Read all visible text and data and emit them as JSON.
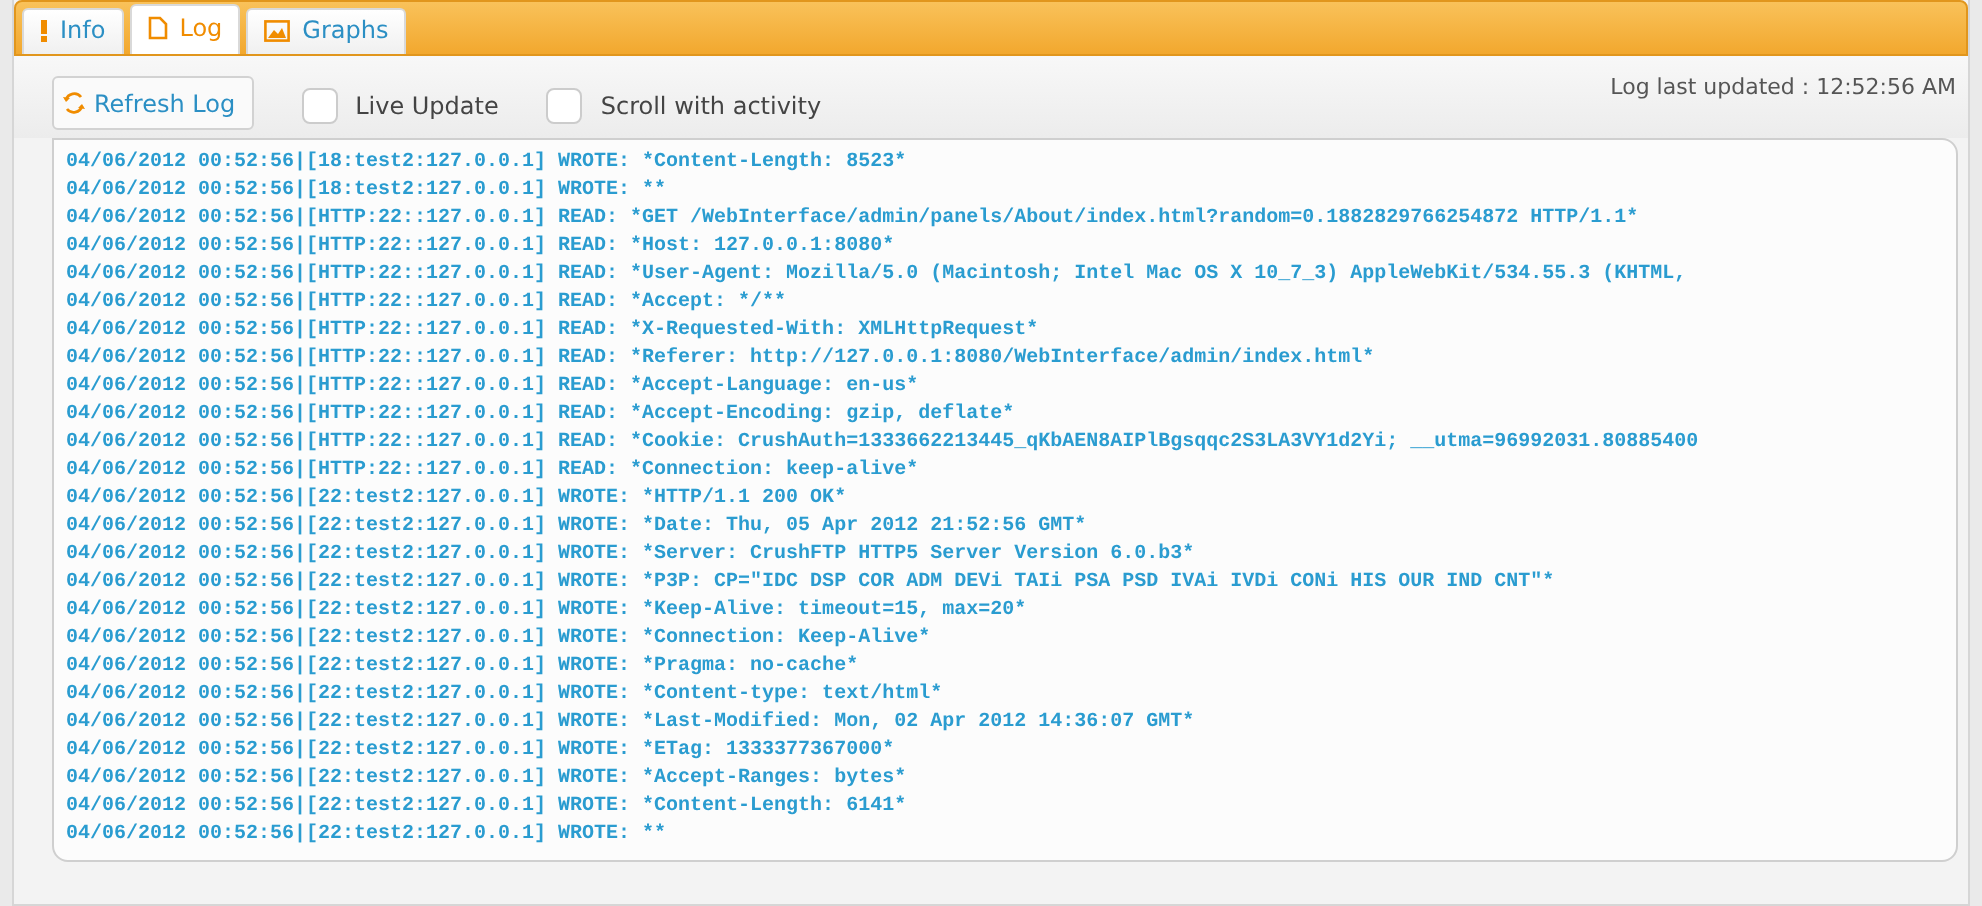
{
  "tabs": [
    {
      "label": "Info",
      "kind": "info",
      "selected": false
    },
    {
      "label": "Log",
      "kind": "log",
      "selected": true
    },
    {
      "label": "Graphs",
      "kind": "graphs",
      "selected": false
    }
  ],
  "toolbar": {
    "refresh_button": "Refresh Log",
    "options": [
      {
        "label": "Live Update",
        "checked": false
      },
      {
        "label": "Scroll with activity",
        "checked": false
      }
    ],
    "last_updated": "Log last updated : 12:52:56 AM"
  },
  "log_lines": [
    "04/06/2012 00:52:56|[18:test2:127.0.0.1] WROTE: *Content-Length: 8523*",
    "04/06/2012 00:52:56|[18:test2:127.0.0.1] WROTE: **",
    "04/06/2012 00:52:56|[HTTP:22::127.0.0.1] READ: *GET /WebInterface/admin/panels/About/index.html?random=0.1882829766254872 HTTP/1.1*",
    "04/06/2012 00:52:56|[HTTP:22::127.0.0.1] READ: *Host: 127.0.0.1:8080*",
    "04/06/2012 00:52:56|[HTTP:22::127.0.0.1] READ: *User-Agent: Mozilla/5.0 (Macintosh; Intel Mac OS X 10_7_3) AppleWebKit/534.55.3 (KHTML,",
    "04/06/2012 00:52:56|[HTTP:22::127.0.0.1] READ: *Accept: */**",
    "04/06/2012 00:52:56|[HTTP:22::127.0.0.1] READ: *X-Requested-With: XMLHttpRequest*",
    "04/06/2012 00:52:56|[HTTP:22::127.0.0.1] READ: *Referer: http://127.0.0.1:8080/WebInterface/admin/index.html*",
    "04/06/2012 00:52:56|[HTTP:22::127.0.0.1] READ: *Accept-Language: en-us*",
    "04/06/2012 00:52:56|[HTTP:22::127.0.0.1] READ: *Accept-Encoding: gzip, deflate*",
    "04/06/2012 00:52:56|[HTTP:22::127.0.0.1] READ: *Cookie: CrushAuth=1333662213445_qKbAEN8AIPlBgsqqc2S3LA3VY1d2Yi; __utma=96992031.80885400",
    "04/06/2012 00:52:56|[HTTP:22::127.0.0.1] READ: *Connection: keep-alive*",
    "04/06/2012 00:52:56|[22:test2:127.0.0.1] WROTE: *HTTP/1.1 200 OK*",
    "04/06/2012 00:52:56|[22:test2:127.0.0.1] WROTE: *Date: Thu, 05 Apr 2012 21:52:56 GMT*",
    "04/06/2012 00:52:56|[22:test2:127.0.0.1] WROTE: *Server: CrushFTP HTTP5 Server Version 6.0.b3*",
    "04/06/2012 00:52:56|[22:test2:127.0.0.1] WROTE: *P3P: CP=\"IDC DSP COR ADM DEVi TAIi PSA PSD IVAi IVDi CONi HIS OUR IND CNT\"*",
    "04/06/2012 00:52:56|[22:test2:127.0.0.1] WROTE: *Keep-Alive: timeout=15, max=20*",
    "04/06/2012 00:52:56|[22:test2:127.0.0.1] WROTE: *Connection: Keep-Alive*",
    "04/06/2012 00:52:56|[22:test2:127.0.0.1] WROTE: *Pragma: no-cache*",
    "04/06/2012 00:52:56|[22:test2:127.0.0.1] WROTE: *Content-type: text/html*",
    "04/06/2012 00:52:56|[22:test2:127.0.0.1] WROTE: *Last-Modified: Mon, 02 Apr 2012 14:36:07 GMT*",
    "04/06/2012 00:52:56|[22:test2:127.0.0.1] WROTE: *ETag: 1333377367000*",
    "04/06/2012 00:52:56|[22:test2:127.0.0.1] WROTE: *Accept-Ranges: bytes*",
    "04/06/2012 00:52:56|[22:test2:127.0.0.1] WROTE: *Content-Length: 6141*",
    "04/06/2012 00:52:56|[22:test2:127.0.0.1] WROTE: **"
  ]
}
